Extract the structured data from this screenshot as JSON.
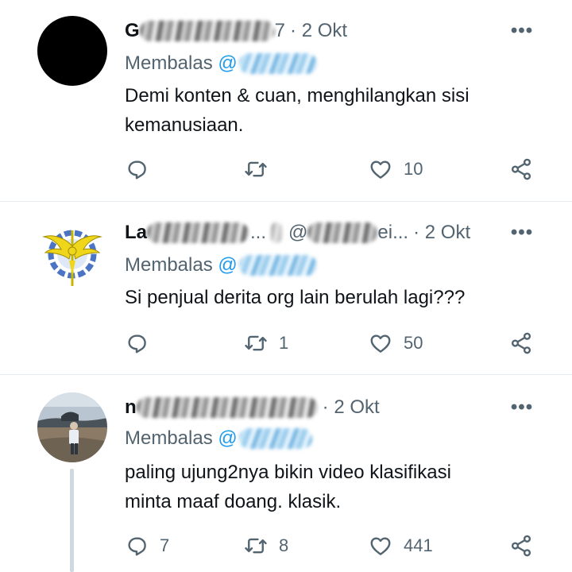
{
  "tweets": [
    {
      "name": "G",
      "handle_suffix": "7",
      "time": "· 2 Okt",
      "replying_label": "Membalas",
      "replying_at": "@",
      "text_lines": [
        "Demi konten & cuan, menghilangkan sisi",
        "kemanusiaan."
      ],
      "actions": {
        "reply": "",
        "retweet": "",
        "like": "10"
      },
      "more": "•••"
    },
    {
      "name": "La",
      "handle_prefix": "...",
      "handle_at": "@",
      "handle_suffix": "ei...",
      "time": "· 2 Okt",
      "replying_label": "Membalas",
      "replying_at": "@",
      "text_lines": [
        "Si penjual derita org lain berulah lagi???"
      ],
      "actions": {
        "reply": "",
        "retweet": "1",
        "like": "50"
      },
      "more": "•••"
    },
    {
      "name": "n",
      "time": "· 2 Okt",
      "replying_label": "Membalas",
      "replying_at": "@",
      "text_lines": [
        "paling ujung2nya bikin video klasifikasi",
        "minta maaf doang.  klasik."
      ],
      "actions": {
        "reply": "7",
        "retweet": "8",
        "like": "441"
      },
      "more": "•••"
    }
  ],
  "colors": {
    "text": "#0f1419",
    "secondary": "#536471",
    "link": "#1d9bf0",
    "divider": "#e6ecf0",
    "thread_line": "#cfd9de"
  },
  "icons": {
    "reply": "reply-icon",
    "retweet": "retweet-icon",
    "like": "heart-icon",
    "share": "share-icon",
    "more": "more-icon"
  }
}
